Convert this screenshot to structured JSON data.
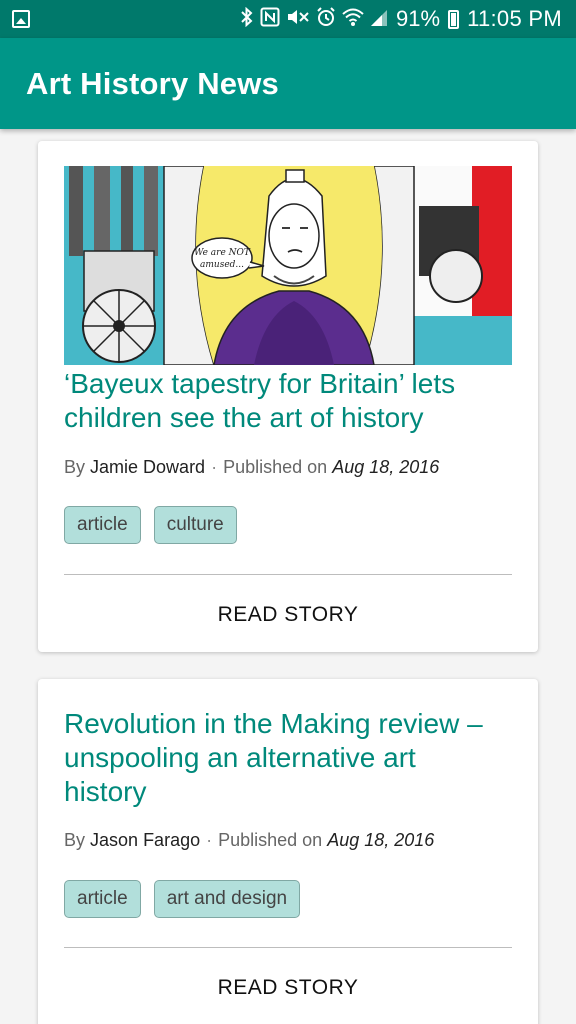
{
  "status_bar": {
    "battery_percent": "91%",
    "time": "11:05 PM",
    "icons": [
      "gallery-icon",
      "bluetooth-icon",
      "nfc-icon",
      "mute-icon",
      "alarm-icon",
      "wifi-icon",
      "signal-icon",
      "battery-charging-icon"
    ]
  },
  "app_bar": {
    "title": "Art History News"
  },
  "articles": [
    {
      "title": "‘Bayeux tapestry for Britain’ lets children see the art of history",
      "by_label": "By",
      "author": "Jamie Doward",
      "separator": "·",
      "published_label": "Published on",
      "date": "Aug 18, 2016",
      "tags": [
        "article",
        "culture"
      ],
      "action_label": "READ STORY",
      "illustration_text": "We are NOT amused..."
    },
    {
      "title": "Revolution in the Making review – unspooling an alternative art history",
      "by_label": "By",
      "author": "Jason Farago",
      "separator": "·",
      "published_label": "Published on",
      "date": "Aug 18, 2016",
      "tags": [
        "article",
        "art and design"
      ],
      "action_label": "READ STORY"
    }
  ],
  "colors": {
    "status_bar": "#00796b",
    "app_bar": "#009688",
    "title_text": "#00897b",
    "tag_background": "#b2dfdb"
  }
}
